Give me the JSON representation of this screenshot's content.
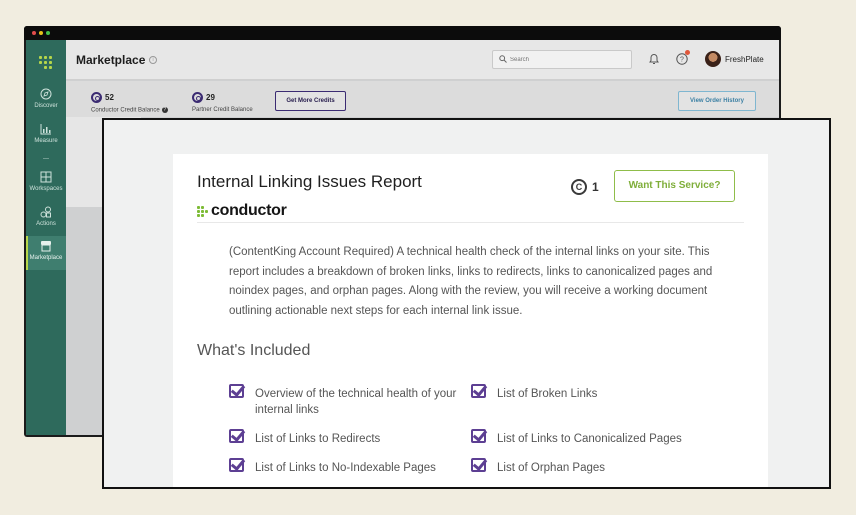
{
  "app": {
    "page_title": "Marketplace",
    "search_placeholder": "Search",
    "user_name": "FreshPlate"
  },
  "sidebar": {
    "items": [
      {
        "label": "Discover",
        "icon": "compass-icon"
      },
      {
        "label": "Measure",
        "icon": "bar-chart-icon"
      },
      {
        "label": "Workspaces",
        "icon": "grid-icon"
      },
      {
        "label": "Actions",
        "icon": "shapes-icon"
      },
      {
        "label": "Marketplace",
        "icon": "store-icon"
      }
    ]
  },
  "credits": {
    "conductor_value": "52",
    "conductor_label": "Conductor Credit Balance",
    "partner_value": "29",
    "partner_label": "Partner Credit Balance",
    "get_more_label": "Get More Credits",
    "order_history_label": "View Order History"
  },
  "service": {
    "title": "Internal Linking Issues Report",
    "brand": "conductor",
    "cost": "1",
    "cta_label": "Want This Service?",
    "description": "(ContentKing Account Required) A technical health check of the internal links on your site. This report includes a breakdown of broken links, links to redirects, links to canonicalized pages and noindex pages, and orphan pages. Along with the review, you will receive a working document outlining actionable next steps for each internal link issue.",
    "included_title": "What's Included",
    "features": [
      "Overview of the technical health of your internal links",
      "List of Broken Links",
      "List of Links to Redirects",
      "List of Links to Canonicalized Pages",
      "List of Links to No-Indexable Pages",
      "List of Orphan Pages"
    ]
  },
  "colors": {
    "sidebar_bg": "#2e6a5c",
    "brand_green": "#7dbb35",
    "accent_purple": "#5d3f93",
    "cta_green": "#7fae3a"
  }
}
